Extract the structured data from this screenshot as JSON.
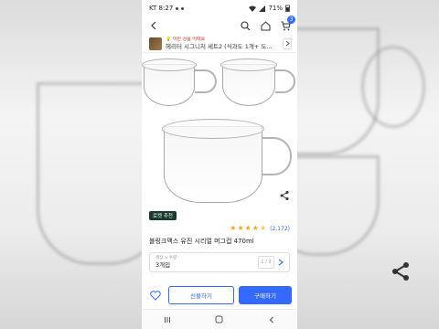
{
  "status_bar": {
    "carrier_time": "KT 8:27",
    "battery": "71%"
  },
  "top_nav": {
    "cart_count": "3"
  },
  "bundle": {
    "promo_text": "💡 이런 상품 어때요",
    "title": "헤리터 시그니처 세트2 (식과도 1개+ 도..."
  },
  "product": {
    "badge": "로켓 추천",
    "rating_stars": 4.5,
    "review_count": "(2,172)",
    "title": "블링크맥스 유진 시리얼 머그컵 470ml"
  },
  "option": {
    "label": "색상 × 수량",
    "value": "3개입",
    "stepper_text": "1 / 3"
  },
  "actions": {
    "cart_label": "선물하기",
    "buy_label": "구매하기"
  },
  "colors": {
    "accent": "#346aff",
    "star": "#f5a623",
    "badge_bg": "#1a3a2e"
  }
}
